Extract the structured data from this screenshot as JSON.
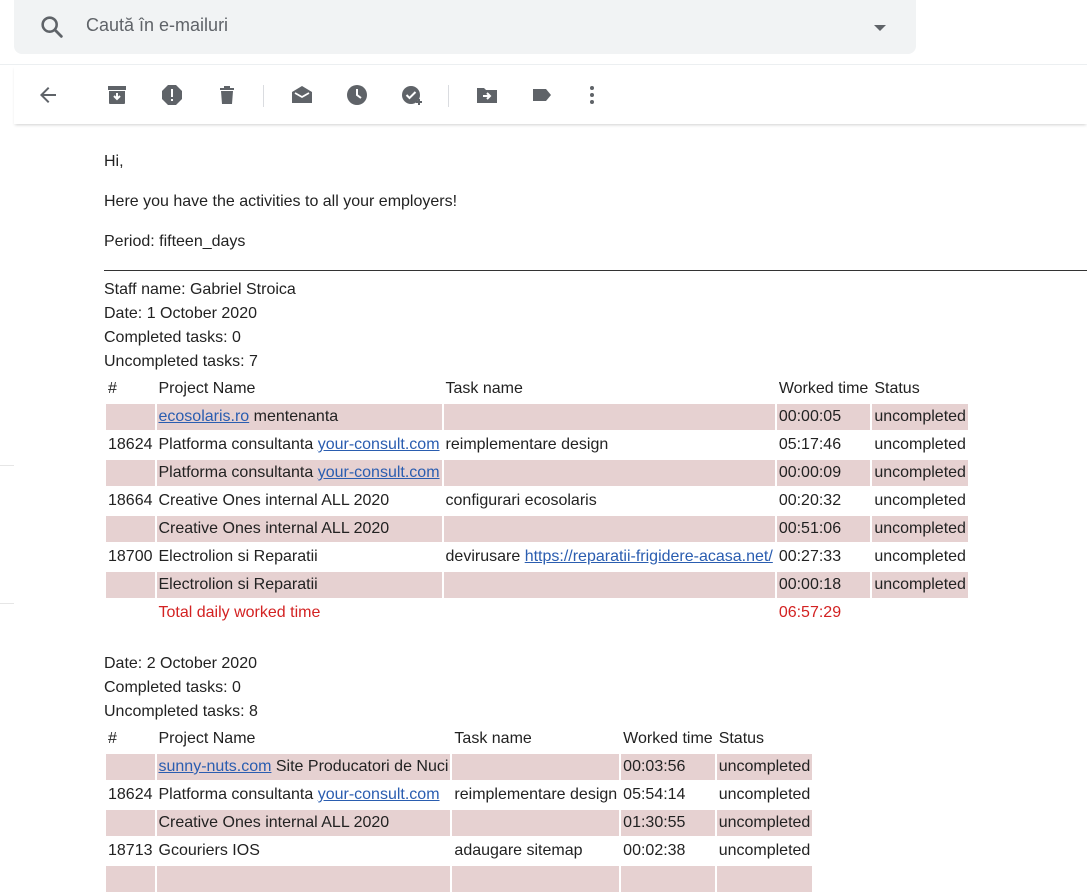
{
  "search": {
    "placeholder": "Caută în e-mailuri"
  },
  "icons": {
    "search": "search-icon",
    "dropdown": "arrow-drop-down-icon",
    "back": "arrow-back-icon",
    "archive": "archive-icon",
    "spam": "report-spam-icon",
    "delete": "trash-icon",
    "mark_unread": "mark-unread-icon",
    "snooze": "snooze-icon",
    "add_task": "add-task-icon",
    "move_to": "move-to-icon",
    "label": "label-icon",
    "more": "more-vert-icon"
  },
  "colors": {
    "row_shade": "#e6d1d1",
    "link": "#2a5db0",
    "total": "#d32222"
  },
  "email": {
    "greeting": "Hi,",
    "intro": "Here you have the activities to all your employers!",
    "period": "Period: fifteen_days",
    "staff_name": "Staff name: Gabriel Stroica",
    "headers": {
      "num": "#",
      "project": "Project Name",
      "task": "Task name",
      "worked": "Worked time",
      "status": "Status"
    },
    "days": [
      {
        "date": "Date: 1 October 2020",
        "completed": "Completed tasks: 0",
        "uncompleted": "Uncompleted tasks: 7",
        "rows": [
          {
            "num": "",
            "project_link": "ecosolaris.ro",
            "project_text": " mentenanta",
            "task": "",
            "task_link": "",
            "worked": "00:00:05",
            "status": "uncompleted"
          },
          {
            "num": "18624",
            "project_text": "Platforma consultanta ",
            "project_link": "your-consult.com",
            "task": "reimplementare design",
            "task_link": "",
            "worked": "05:17:46",
            "status": "uncompleted"
          },
          {
            "num": "",
            "project_text": "Platforma consultanta ",
            "project_link": "your-consult.com",
            "task": "",
            "task_link": "",
            "worked": "00:00:09",
            "status": "uncompleted"
          },
          {
            "num": "18664",
            "project_text": "Creative Ones internal ALL 2020",
            "project_link": "",
            "task": "configurari ecosolaris",
            "task_link": "",
            "worked": "00:20:32",
            "status": "uncompleted"
          },
          {
            "num": "",
            "project_text": "Creative Ones internal ALL 2020",
            "project_link": "",
            "task": "",
            "task_link": "",
            "worked": "00:51:06",
            "status": "uncompleted"
          },
          {
            "num": "18700",
            "project_text": "Electrolion si Reparatii",
            "project_link": "",
            "task": "devirusare ",
            "task_link": "https://reparatii-frigidere-acasa.net/",
            "worked": "00:27:33",
            "status": "uncompleted"
          },
          {
            "num": "",
            "project_text": "Electrolion si Reparatii",
            "project_link": "",
            "task": "",
            "task_link": "",
            "worked": "00:00:18",
            "status": "uncompleted"
          }
        ],
        "total_label": "Total daily worked time",
        "total_time": "06:57:29"
      },
      {
        "date": "Date: 2 October 2020",
        "completed": "Completed tasks: 0",
        "uncompleted": "Uncompleted tasks: 8",
        "rows": [
          {
            "num": "",
            "project_link": "sunny-nuts.com",
            "project_text": " Site Producatori de Nuci",
            "task": "",
            "task_link": "",
            "worked": "00:03:56",
            "status": "uncompleted"
          },
          {
            "num": "18624",
            "project_text": "Platforma consultanta ",
            "project_link": "your-consult.com",
            "task": "reimplementare design",
            "task_link": "",
            "worked": "05:54:14",
            "status": "uncompleted"
          },
          {
            "num": "",
            "project_text": "Creative Ones internal ALL 2020",
            "project_link": "",
            "task": "",
            "task_link": "",
            "worked": "01:30:55",
            "status": "uncompleted"
          },
          {
            "num": "18713",
            "project_text": "Gcouriers IOS",
            "project_link": "",
            "task": "adaugare sitemap",
            "task_link": "",
            "worked": "00:02:38",
            "status": "uncompleted"
          }
        ]
      }
    ]
  }
}
